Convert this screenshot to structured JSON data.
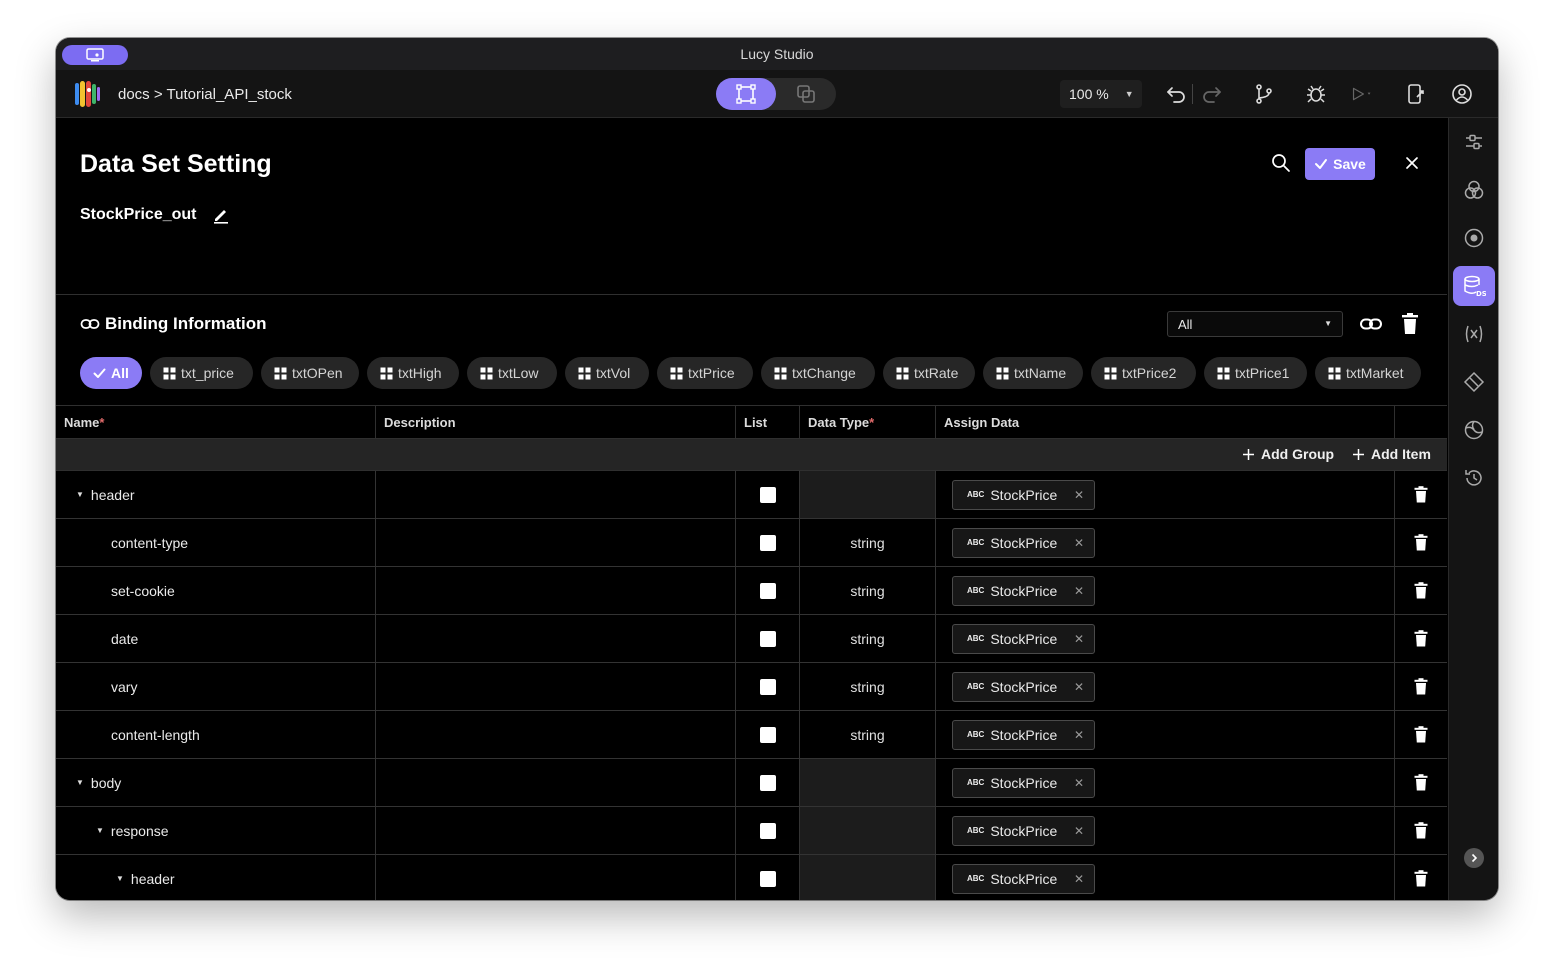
{
  "window": {
    "title": "Lucy Studio"
  },
  "toolbar": {
    "breadcrumb": "docs > Tutorial_API_stock",
    "zoom": "100 %"
  },
  "panel": {
    "title": "Data Set Setting",
    "save_label": "Save",
    "dataset_name": "StockPrice_out"
  },
  "binding": {
    "title": "Binding Information",
    "filter_value": "All",
    "chips": [
      {
        "label": "All",
        "active": true
      },
      {
        "label": "txt_price"
      },
      {
        "label": "txtOPen"
      },
      {
        "label": "txtHigh"
      },
      {
        "label": "txtLow"
      },
      {
        "label": "txtVol"
      },
      {
        "label": "txtPrice"
      },
      {
        "label": "txtChange"
      },
      {
        "label": "txtRate"
      },
      {
        "label": "txtName"
      },
      {
        "label": "txtPrice2"
      },
      {
        "label": "txtPrice1"
      },
      {
        "label": "txtMarket"
      }
    ]
  },
  "table": {
    "columns": {
      "name": "Name",
      "description": "Description",
      "list": "List",
      "data_type": "Data Type",
      "assign_data": "Assign Data",
      "required_mark": "*"
    },
    "add_group_label": "Add Group",
    "add_item_label": "Add Item",
    "assign_badge": "ABC",
    "rows": [
      {
        "name": "header",
        "level": 0,
        "expandable": true,
        "type": "",
        "assign": "StockPrice"
      },
      {
        "name": "content-type",
        "level": 1,
        "expandable": false,
        "type": "string",
        "assign": "StockPrice"
      },
      {
        "name": "set-cookie",
        "level": 1,
        "expandable": false,
        "type": "string",
        "assign": "StockPrice"
      },
      {
        "name": "date",
        "level": 1,
        "expandable": false,
        "type": "string",
        "assign": "StockPrice"
      },
      {
        "name": "vary",
        "level": 1,
        "expandable": false,
        "type": "string",
        "assign": "StockPrice"
      },
      {
        "name": "content-length",
        "level": 1,
        "expandable": false,
        "type": "string",
        "assign": "StockPrice"
      },
      {
        "name": "body",
        "level": 0,
        "expandable": true,
        "type": "",
        "assign": "StockPrice"
      },
      {
        "name": "response",
        "level": 1,
        "expandable": true,
        "type": "",
        "assign": "StockPrice"
      },
      {
        "name": "header",
        "level": 2,
        "expandable": true,
        "type": "",
        "assign": "StockPrice"
      }
    ]
  },
  "colors": {
    "accent": "#8b7bf5",
    "background": "#000000",
    "toolbar": "#141414"
  }
}
